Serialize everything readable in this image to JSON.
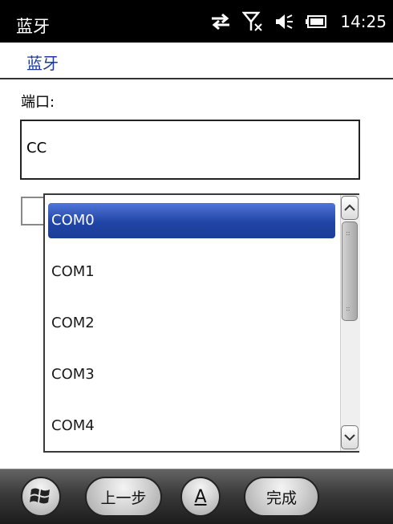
{
  "status_bar": {
    "title": "蓝牙",
    "time": "14:25",
    "icons": [
      "connectivity-icon",
      "signal-off-icon",
      "volume-icon",
      "battery-icon"
    ]
  },
  "header": {
    "title": "蓝牙"
  },
  "form": {
    "port_label": "端口:",
    "combo_partial_text": "CC"
  },
  "dropdown": {
    "selected_index": 0,
    "items": [
      "COM0",
      "COM1",
      "COM2",
      "COM3",
      "COM4"
    ]
  },
  "softkeys": {
    "start_icon": "windows-start-icon",
    "back_label": "上一步",
    "input_label": "A",
    "done_label": "完成"
  },
  "colors": {
    "selection": "#2145a6",
    "header_text": "#1b3a9c"
  }
}
